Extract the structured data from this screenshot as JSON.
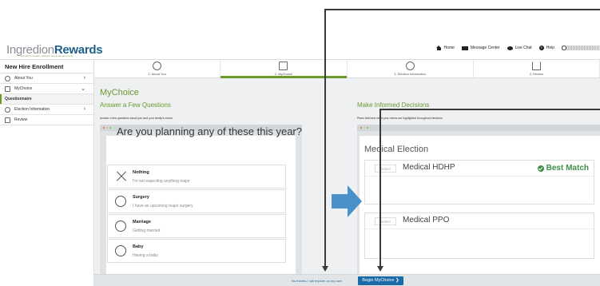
{
  "header": {
    "logo_part1": "Ingredion",
    "logo_part2": "Rewards",
    "logo_tagline": "benefits for health, wellness and financial security",
    "nav": {
      "home": "Home",
      "message_center": "Message Center",
      "live_chat": "Live Chat",
      "help": "Help"
    }
  },
  "sidebar": {
    "title": "New Hire Enrollment",
    "items": [
      {
        "label": "About You"
      },
      {
        "label": "MyChoice"
      },
      {
        "label": "Questionnaire"
      },
      {
        "label": "Election Information"
      },
      {
        "label": "Review"
      }
    ]
  },
  "steps": [
    {
      "label": "1. About You"
    },
    {
      "label": "2. MyChoice"
    },
    {
      "label": "3. Election Information"
    },
    {
      "label": "4. Review"
    }
  ],
  "main": {
    "heading": "MyChoice",
    "left_heading": "Answer a Few Questions",
    "left_sub": "Answer a few questions about you and your family's needs",
    "right_heading": "Make Informed Decisions",
    "right_sub": "Plans that best meet your needs are highlighted throughout elections"
  },
  "questionnaire": {
    "question": "Are you planning any of these this year?",
    "options": [
      {
        "title": "Nothing",
        "sub": "I'm not expecting anything major"
      },
      {
        "title": "Surgery",
        "sub": "I have an upcoming major surgery"
      },
      {
        "title": "Marriage",
        "sub": "Getting married"
      },
      {
        "title": "Baby",
        "sub": "Having a baby"
      }
    ]
  },
  "election": {
    "title": "Medical Election",
    "plans": [
      {
        "select": "Select",
        "name": "Medical HDHP",
        "badge": "Best Match"
      },
      {
        "select": "Select",
        "name": "Medical PPO"
      }
    ]
  },
  "footer": {
    "no_thanks": "No thanks, I will explore on my own",
    "begin": "Begin MyChoice ❯"
  },
  "colors": {
    "brand_green": "#6a9a2e",
    "brand_blue": "#1f5f8b",
    "button_blue": "#1b6aa8",
    "best_match_green": "#3e8f4a",
    "arrow_blue": "#4a90c9"
  }
}
